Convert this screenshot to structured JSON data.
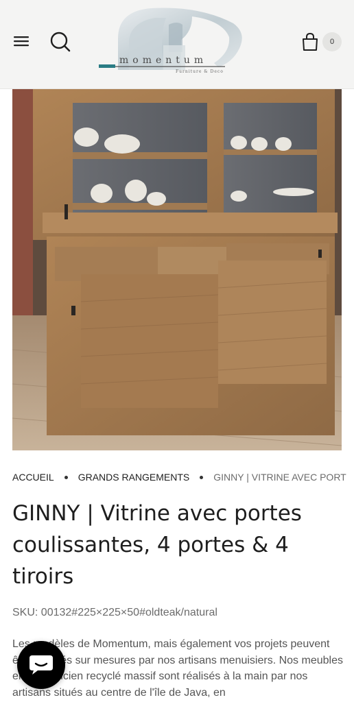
{
  "header": {
    "logo": {
      "wordmark": "momentum",
      "tagline": "Furniture & Deco"
    },
    "cart_count": "0"
  },
  "icons": {
    "menu": "hamburger-menu-icon",
    "search": "search-icon",
    "cart": "shopping-bag-icon",
    "chat": "chat-bubble-icon"
  },
  "colors": {
    "accent": "#2a7c84",
    "header_bg": "#f4f4f3",
    "chat_bg": "#000000"
  },
  "breadcrumb": {
    "items": [
      "ACCUEIL",
      "GRANDS RANGEMENTS"
    ],
    "current": "GINNY | VITRINE AVEC PORT"
  },
  "product": {
    "title": "GINNY | Vitrine avec portes coulissantes, 4 portes & 4 tiroirs",
    "sku_label": "SKU:",
    "sku_value": "00132#225×225×50#oldteak/natural",
    "description": "Les modèles de Momentum, mais également vos projets peuvent être réalisés sur mesures par nos artisans menuisiers. Nos meubles en teck ancien recyclé massif sont réalisés à la main par nos artisans situés au centre de l'île de Java, en"
  }
}
